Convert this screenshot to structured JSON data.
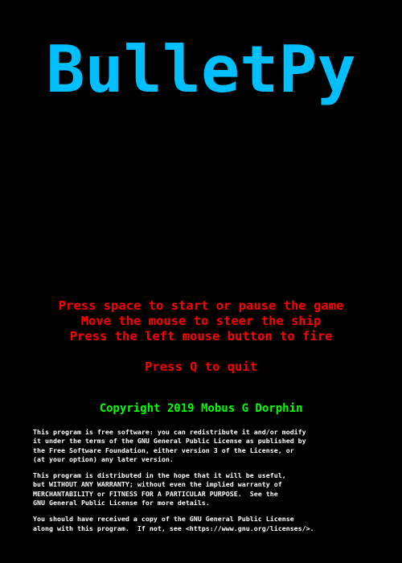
{
  "game": {
    "title": "BulletPy"
  },
  "instructions": [
    "Press space to start or pause the game",
    "Move the mouse to steer the ship",
    "Press the left mouse button to fire"
  ],
  "quit_text": "Press Q to quit",
  "copyright": "Copyright 2019 Mobus G Dorphin",
  "license": {
    "paragraph_1": [
      "This program is free software: you can redistribute it and/or modify",
      "it under the terms of the GNU General Public License as published by",
      "the Free Software Foundation, either version 3 of the License, or",
      "(at your option) any later version."
    ],
    "paragraph_2": [
      "This program is distributed in the hope that it will be useful,",
      "but WITHOUT ANY WARRANTY; without even the implied warranty of",
      "MERCHANTABILITY or FITNESS FOR A PARTICULAR PURPOSE.  See the",
      "GNU General Public License for more details."
    ],
    "paragraph_3": [
      "You should have received a copy of the GNU General Public License",
      "along with this program.  If not, see <https://www.gnu.org/licenses/>."
    ]
  },
  "colors": {
    "background": "#000000",
    "title": "#00bfff",
    "instructions": "#ff0000",
    "copyright": "#00ff00",
    "license": "#ffffff"
  }
}
